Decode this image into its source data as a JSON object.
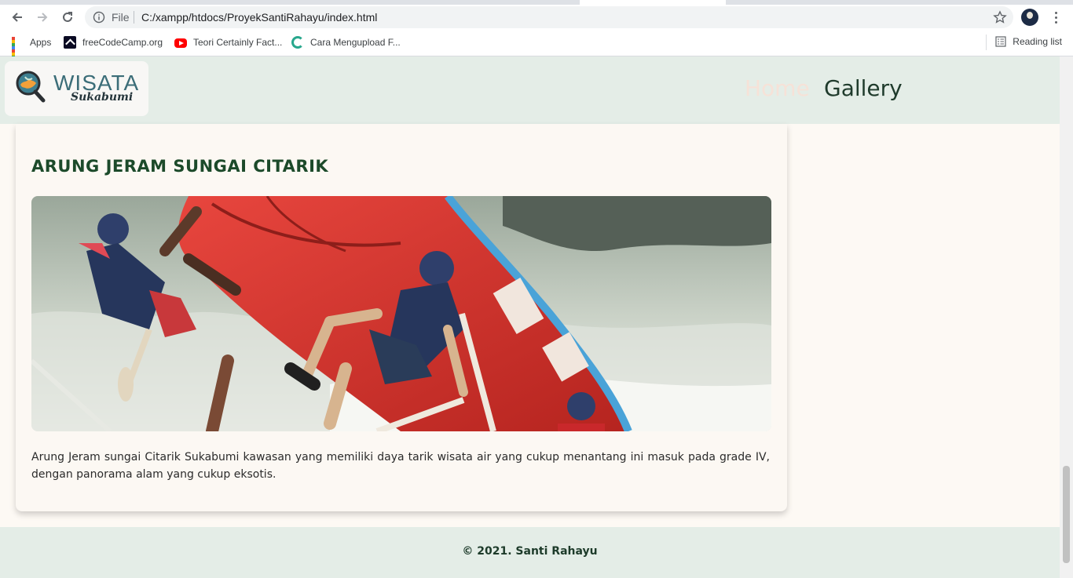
{
  "browser": {
    "file_label": "File",
    "url": "C:/xampp/htdocs/ProyekSantiRahayu/index.html",
    "bookmarks": [
      {
        "label": "Apps",
        "icon": "apps-grid-icon"
      },
      {
        "label": "freeCodeCamp.org",
        "icon": "freecodecamp-icon"
      },
      {
        "label": "Teori Certainly Fact...",
        "icon": "youtube-icon"
      },
      {
        "label": "Cara Mengupload F...",
        "icon": "site-favicon-icon"
      }
    ],
    "reading_list": "Reading list"
  },
  "site": {
    "logo": {
      "title": "WISATA",
      "subtitle": "Sukabumi"
    },
    "nav": {
      "home": "Home",
      "gallery": "Gallery"
    },
    "colors": {
      "header_bg": "#e4ede7",
      "accent": "#1c4a2a",
      "home_link": "#f6e2d8"
    }
  },
  "card": {
    "title": "ARUNG JERAM SUNGAI CITARIK",
    "description": "Arung Jeram sungai Citarik Sukabumi kawasan yang memiliki daya tarik wisata air yang cukup menantang ini masuk pada grade IV, dengan panorama alam yang cukup eksotis."
  },
  "footer": {
    "text": "© 2021. Santi Rahayu"
  }
}
